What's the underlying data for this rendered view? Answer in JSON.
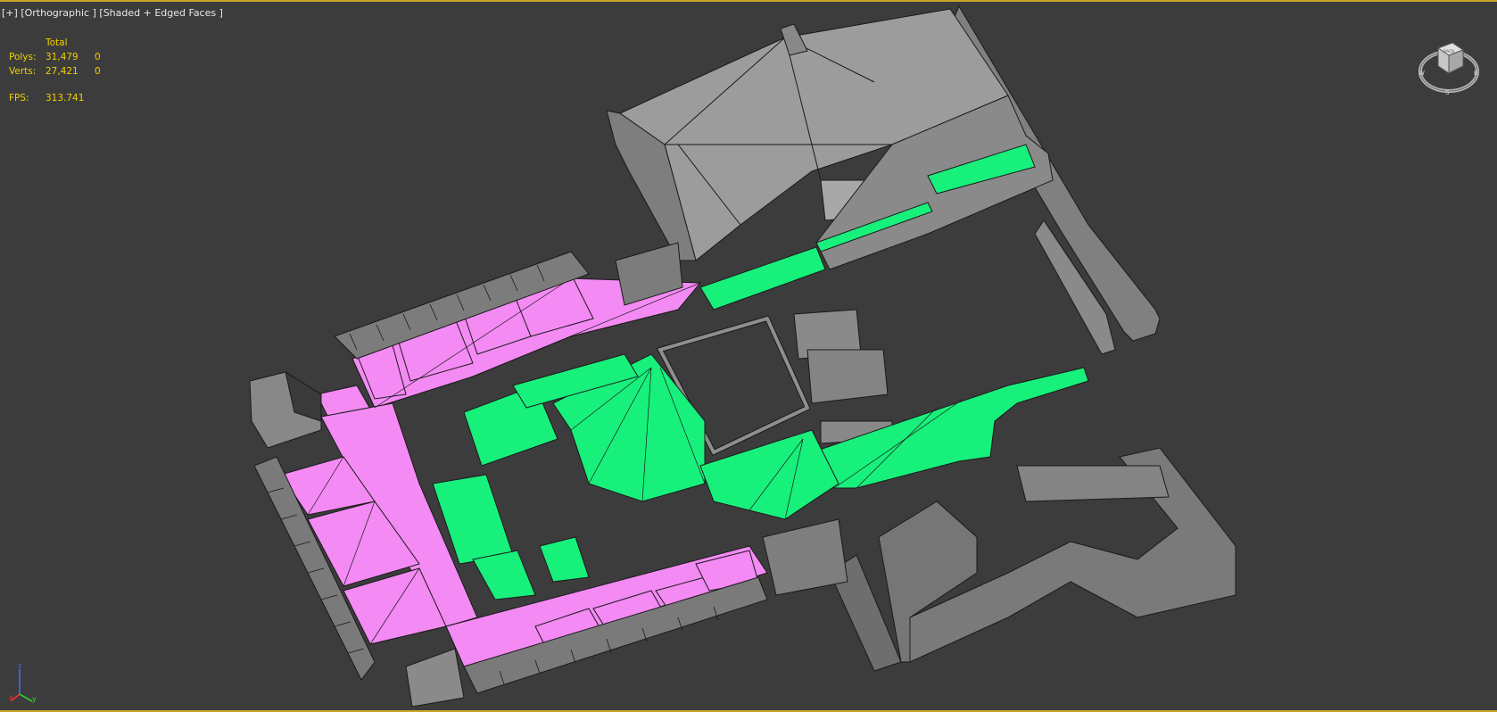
{
  "viewport": {
    "label_parts": [
      "[+]",
      "[Orthographic ]",
      "[Shaded + Edged Faces ]"
    ]
  },
  "stats": {
    "header": "Total",
    "rows": [
      {
        "label": "Polys:",
        "value": "31,479",
        "extra": "0"
      },
      {
        "label": "Verts:",
        "value": "27,421",
        "extra": "0"
      }
    ],
    "fps_label": "FPS:",
    "fps_value": "313.741"
  },
  "colors": {
    "background": "#3c3c3c",
    "active_border": "#c8a82a",
    "stats_text": "#f0d000",
    "floor_pink": "#f48af4",
    "floor_green": "#18f07c",
    "wall_gray": "#8e8e8e",
    "wall_light": "#a4a4a4",
    "roof_gray": "#9c9c9c"
  },
  "viewcube": {
    "face_label": "BACK",
    "compass": [
      "W",
      "S",
      "E",
      "N"
    ]
  },
  "axis": {
    "x": "x",
    "y": "y",
    "z": "z"
  }
}
